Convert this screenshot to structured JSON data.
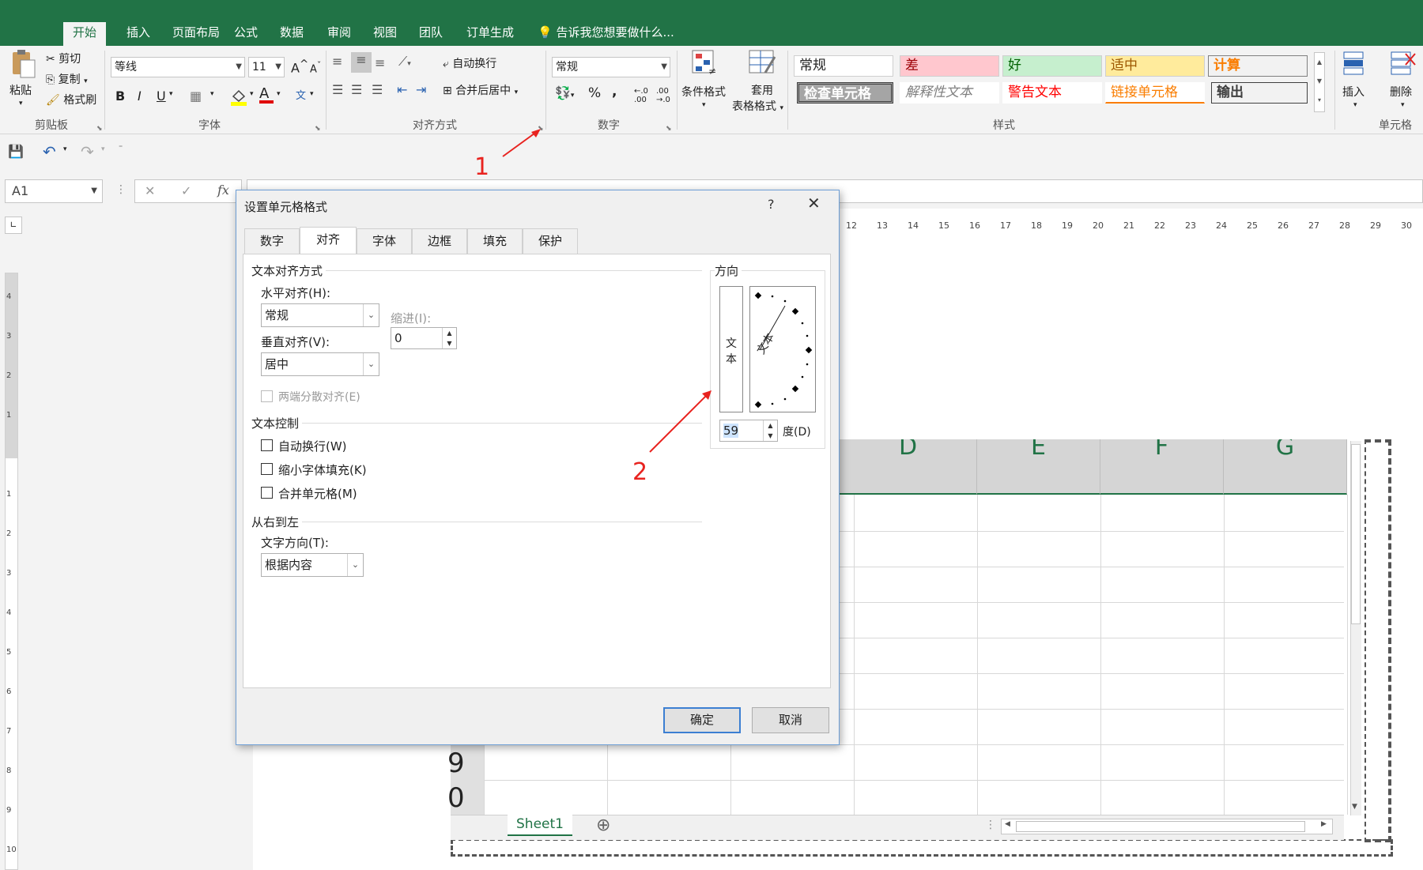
{
  "ribbon": {
    "tabs": [
      "开始",
      "插入",
      "页面布局",
      "公式",
      "数据",
      "审阅",
      "视图",
      "团队",
      "订单生成"
    ],
    "tell_me": "告诉我您想要做什么...",
    "clipboard": {
      "paste": "粘贴",
      "cut": "剪切",
      "copy": "复制",
      "format_painter": "格式刷",
      "group": "剪贴板"
    },
    "font": {
      "name": "等线",
      "size": "11",
      "bold": "B",
      "italic": "I",
      "underline": "U",
      "grow": "A",
      "shrink": "A",
      "font_color_glyph": "A",
      "phonetic": "文",
      "group": "字体"
    },
    "alignment": {
      "wrap": "自动换行",
      "merge": "合并后居中",
      "group": "对齐方式"
    },
    "number": {
      "format": "常规",
      "percent": "%",
      "comma": ",",
      "inc_decimal": "←.0 .00",
      "dec_decimal": ".00 →.0",
      "group": "数字"
    },
    "conditional": "条件格式",
    "table_format_line1": "套用",
    "table_format_line2": "表格格式",
    "styles": {
      "normal": "常规",
      "bad": "差",
      "good": "好",
      "neutral": "适中",
      "calc": "计算",
      "check": "检查单元格",
      "explanatory": "解释性文本",
      "warning": "警告文本",
      "link": "链接单元格",
      "output": "输出",
      "group": "样式"
    },
    "cells": {
      "insert": "插入",
      "delete": "删除",
      "group": "单元格"
    },
    "colors": {
      "green": "#217346",
      "bad_bg": "#ffc7ce",
      "good_bg": "#c6efce",
      "neutral_bg": "#ffeb9c"
    }
  },
  "formula_bar": {
    "name_box": "A1",
    "cancel": "✕",
    "enter": "✓",
    "fx": "fx"
  },
  "ruler": {
    "h_ticks": [
      "12",
      "13",
      "14",
      "15",
      "16",
      "17",
      "18",
      "19",
      "20",
      "21",
      "22",
      "23",
      "24",
      "25",
      "26",
      "27",
      "28",
      "29",
      "30"
    ],
    "v_ticks": [
      "4",
      "3",
      "2",
      "1",
      "1",
      "2",
      "3",
      "4",
      "5",
      "6",
      "7",
      "8",
      "9",
      "10"
    ]
  },
  "sheet": {
    "columns": [
      "D",
      "E",
      "F",
      "G"
    ],
    "row_labels": [
      "9",
      "0"
    ],
    "tab": "Sheet1",
    "add_sheet": "⊕"
  },
  "dialog": {
    "title": "设置单元格格式",
    "help": "?",
    "close": "✕",
    "tabs": [
      "数字",
      "对齐",
      "字体",
      "边框",
      "填充",
      "保护"
    ],
    "active_tab": "对齐",
    "text_alignment": {
      "section": "文本对齐方式",
      "horizontal_label": "水平对齐(H):",
      "horizontal_value": "常规",
      "vertical_label": "垂直对齐(V):",
      "vertical_value": "居中",
      "indent_label": "缩进(I):",
      "indent_value": "0",
      "justify_distributed": "两端分散对齐(E)"
    },
    "text_control": {
      "section": "文本控制",
      "wrap": "自动换行(W)",
      "shrink": "缩小字体填充(K)",
      "merge": "合并单元格(M)"
    },
    "rtl": {
      "section": "从右到左",
      "direction_label": "文字方向(T):",
      "direction_value": "根据内容"
    },
    "orientation": {
      "section": "方向",
      "vertical_text_1": "文",
      "vertical_text_2": "本",
      "dial_text": "文本",
      "degrees_value": "59",
      "degrees_label": "度(D)"
    },
    "ok": "确定",
    "cancel": "取消"
  },
  "annotations": {
    "one": "1",
    "two": "2",
    "color": "#e8231f"
  }
}
